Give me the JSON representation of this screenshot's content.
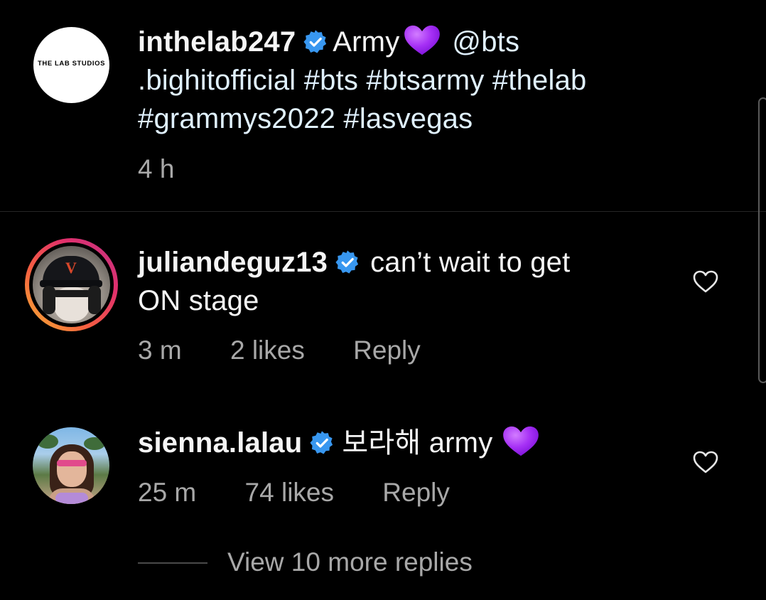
{
  "post": {
    "username": "inthelab247",
    "text_part1": "Army",
    "text_line1_tail": "@bts",
    "text_line2": ".bighitofficial #bts #btsarmy #thelab",
    "text_line3": "#grammys2022 #lasvegas",
    "time": "4 h",
    "avatar_text": "THE LAB STUDIOS",
    "emoji": "purple-heart"
  },
  "comments": [
    {
      "username": "juliandeguz13",
      "text_line1": "can’t wait to get",
      "text_line2": "ON stage",
      "time": "3 m",
      "likes": "2 likes",
      "reply": "Reply",
      "avatar_letter": "V"
    },
    {
      "username": "sienna.lalau",
      "text": "보라해 army",
      "time": "25 m",
      "likes": "74 likes",
      "reply": "Reply",
      "emoji": "purple-heart"
    }
  ],
  "view_more": "View 10 more replies",
  "colors": {
    "background": "#000000",
    "text": "#f5f5f5",
    "secondary": "#a8a8a8",
    "verified": "#3897f0",
    "emoji_heart": "#9b2cf0",
    "link": "#e0f1ff"
  },
  "icons": [
    "verified-badge-icon",
    "heart-outline-icon",
    "purple-heart-emoji"
  ]
}
